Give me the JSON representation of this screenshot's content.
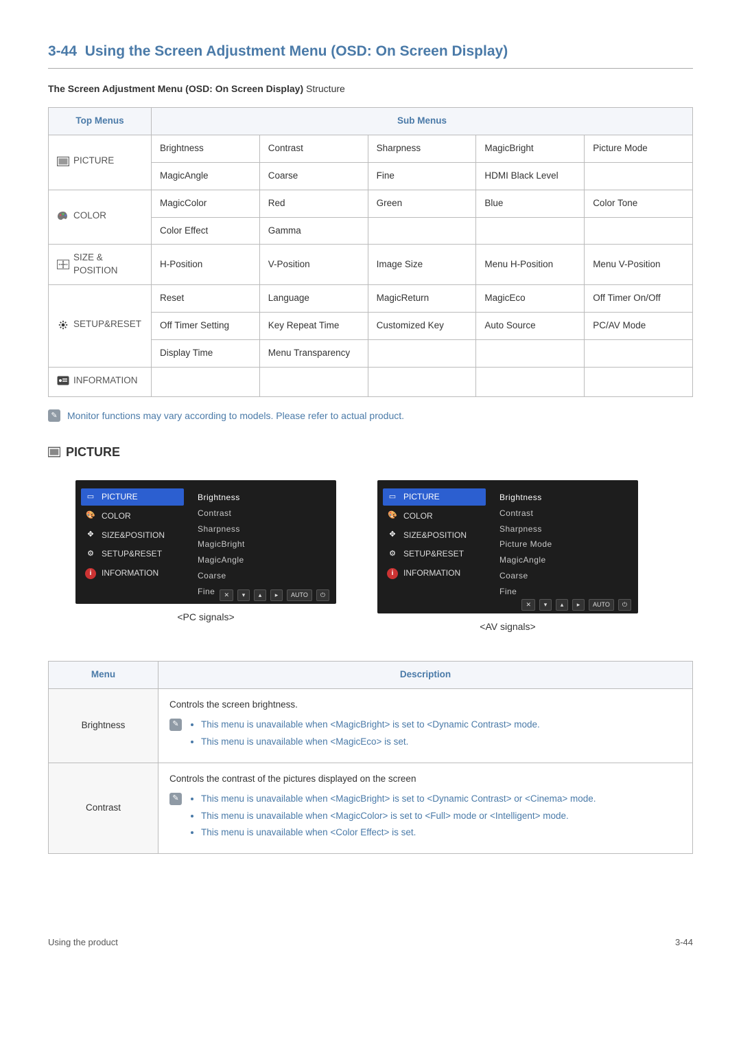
{
  "section": {
    "number": "3-44",
    "title": "Using the Screen Adjustment Menu (OSD: On Screen Display)"
  },
  "structure_intro": {
    "bold": "The Screen Adjustment Menu (OSD: On Screen Display)",
    "rest": " Structure"
  },
  "structure_table": {
    "header_top": "Top Menus",
    "header_sub": "Sub Menus",
    "groups": [
      {
        "label": "PICTURE",
        "icon": "picture-icon",
        "rows": [
          [
            "Brightness",
            "Contrast",
            "Sharpness",
            "MagicBright",
            "Picture Mode"
          ],
          [
            "MagicAngle",
            "Coarse",
            "Fine",
            "HDMI Black Level",
            ""
          ]
        ]
      },
      {
        "label": "COLOR",
        "icon": "palette-icon",
        "rows": [
          [
            "MagicColor",
            "Red",
            "Green",
            "Blue",
            "Color Tone"
          ],
          [
            "Color Effect",
            "Gamma",
            "",
            "",
            ""
          ]
        ]
      },
      {
        "label": "SIZE & POSITION",
        "icon": "size-icon",
        "rows": [
          [
            "H-Position",
            "V-Position",
            "Image Size",
            "Menu H-Position",
            "Menu V-Position"
          ]
        ]
      },
      {
        "label": "SETUP&RESET",
        "icon": "gear-icon",
        "rows": [
          [
            "Reset",
            "Language",
            "MagicReturn",
            "MagicEco",
            "Off Timer On/Off"
          ],
          [
            "Off Timer Setting",
            "Key Repeat Time",
            "Customized Key",
            "Auto Source",
            "PC/AV Mode"
          ],
          [
            "Display Time",
            "Menu Transparency",
            "",
            "",
            ""
          ]
        ]
      },
      {
        "label": "INFORMATION",
        "icon": "info-icon",
        "rows": [
          [
            "",
            "",
            "",
            "",
            ""
          ]
        ]
      }
    ]
  },
  "top_note": "Monitor functions may vary according to models. Please refer to actual product.",
  "picture_heading": "PICTURE",
  "osd": {
    "left_items": [
      "PICTURE",
      "COLOR",
      "SIZE&POSITION",
      "SETUP&RESET",
      "INFORMATION"
    ],
    "footer": [
      "✕",
      "▾",
      "▴",
      "▸",
      "AUTO",
      "⏻"
    ],
    "panels": [
      {
        "caption": "<PC signals>",
        "options": [
          "Brightness",
          "Contrast",
          "Sharpness",
          "MagicBright",
          "MagicAngle",
          "Coarse",
          "Fine"
        ]
      },
      {
        "caption": "<AV signals>",
        "options": [
          "Brightness",
          "Contrast",
          "Sharpness",
          "Picture Mode",
          "MagicAngle",
          "Coarse",
          "Fine"
        ],
        "show_arrow": true
      }
    ]
  },
  "desc_table": {
    "header_menu": "Menu",
    "header_desc": "Description",
    "rows": [
      {
        "menu": "Brightness",
        "intro": "Controls the screen brightness.",
        "notes": [
          "This menu is unavailable when <MagicBright> is set to <Dynamic Contrast> mode.",
          "This menu is unavailable when <MagicEco> is set."
        ]
      },
      {
        "menu": "Contrast",
        "intro": "Controls the contrast of the pictures displayed on the screen",
        "notes": [
          "This menu is unavailable when <MagicBright> is set to <Dynamic Contrast> or <Cinema> mode.",
          "This menu is unavailable when <MagicColor> is set to <Full> mode or <Intelligent> mode.",
          "This menu is unavailable when <Color Effect> is set."
        ]
      }
    ]
  },
  "footer": {
    "left": "Using the product",
    "right": "3-44"
  }
}
